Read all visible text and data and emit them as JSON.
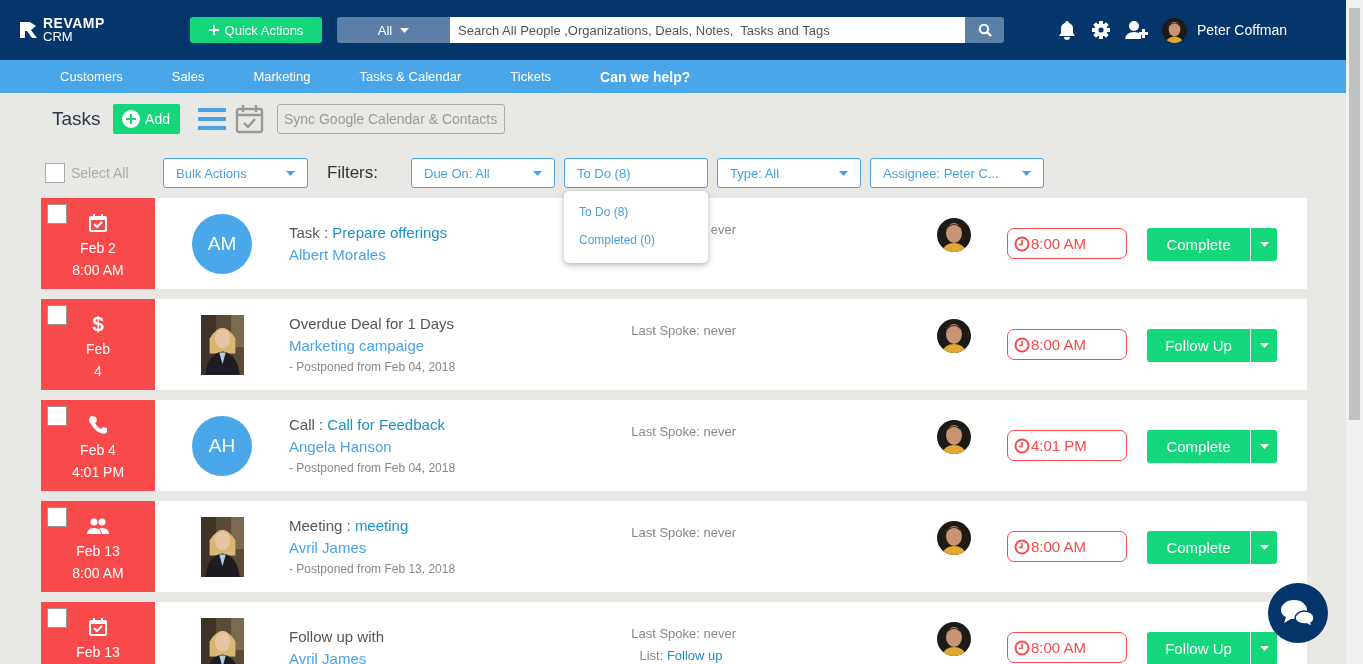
{
  "header": {
    "logo": "REVAMP",
    "logo_sub": "CRM",
    "quick_actions": "Quick Actions",
    "search_scope": "All",
    "search_placeholder": "Search All People ,Organizations, Deals, Notes,  Tasks and Tags",
    "user_name": "Peter Coffman"
  },
  "nav": [
    {
      "label": "Customers",
      "bold": false
    },
    {
      "label": "Sales",
      "bold": false
    },
    {
      "label": "Marketing",
      "bold": false
    },
    {
      "label": "Tasks & Calendar",
      "bold": false
    },
    {
      "label": "Tickets",
      "bold": false
    },
    {
      "label": "Can we help?",
      "bold": true
    }
  ],
  "toolbar": {
    "title": "Tasks",
    "add": "Add",
    "sync": "Sync Google Calendar & Contacts"
  },
  "filters": {
    "select_all": {
      "label": "Select All",
      "checked": false
    },
    "bulk_actions": "Bulk Actions",
    "label": "Filters:",
    "dropdowns": [
      {
        "label": "Due On: All",
        "open": false
      },
      {
        "label": "To Do (8)",
        "open": true,
        "options": [
          "To Do (8)",
          "Completed (0)"
        ]
      },
      {
        "label": "Type: All",
        "open": false
      },
      {
        "label": "Assignee: Peter C...",
        "open": false
      }
    ]
  },
  "tasks": [
    {
      "kind": "task",
      "overdue": true,
      "checked": false,
      "date": [
        "Feb 2",
        "8:00 AM"
      ],
      "avatar": {
        "kind": "initials",
        "text": "AM"
      },
      "title": {
        "prefix": "Task :",
        "link": "Prepare offerings"
      },
      "contact": "Albert Morales",
      "last_spoke": "ever",
      "time": "8:00 AM",
      "action": "Complete"
    },
    {
      "kind": "deal",
      "icon_text": "$",
      "overdue": true,
      "checked": false,
      "date": [
        "Feb",
        "4"
      ],
      "avatar": {
        "kind": "picture"
      },
      "title": {
        "text": "Overdue Deal for 1 Days"
      },
      "contact": "Marketing campaige",
      "note": "- Postponed from Feb 04, 2018",
      "last_spoke": "Last Spoke: never",
      "time": "8:00 AM",
      "action": "Follow Up"
    },
    {
      "kind": "call",
      "overdue": true,
      "checked": false,
      "date": [
        "Feb 4",
        "4:01 PM"
      ],
      "avatar": {
        "kind": "initials",
        "text": "AH"
      },
      "title": {
        "prefix": "Call :",
        "link": "Call for Feedback"
      },
      "contact": "Angela Hanson",
      "note": "- Postponed from Feb 04, 2018",
      "last_spoke": "Last Spoke: never",
      "time": "4:01 PM",
      "action": "Complete"
    },
    {
      "kind": "meeting",
      "overdue": true,
      "checked": false,
      "date": [
        "Feb 13",
        "8:00 AM"
      ],
      "avatar": {
        "kind": "picture"
      },
      "title": {
        "prefix": "Meeting :",
        "link": "meeting"
      },
      "contact": "Avril James",
      "note": "- Postponed from Feb 13, 2018",
      "last_spoke": "Last Spoke: never",
      "time": "8:00 AM",
      "action": "Complete"
    },
    {
      "kind": "task",
      "overdue": true,
      "checked": false,
      "date": [
        "Feb 13"
      ],
      "avatar": {
        "kind": "picture"
      },
      "title": {
        "text": "Follow up with"
      },
      "contact": "Avril James",
      "last_spoke": "Last Spoke: never",
      "list": {
        "label": "List:",
        "link": "Follow up"
      },
      "time": "8:00 AM",
      "action": "Follow Up"
    }
  ]
}
